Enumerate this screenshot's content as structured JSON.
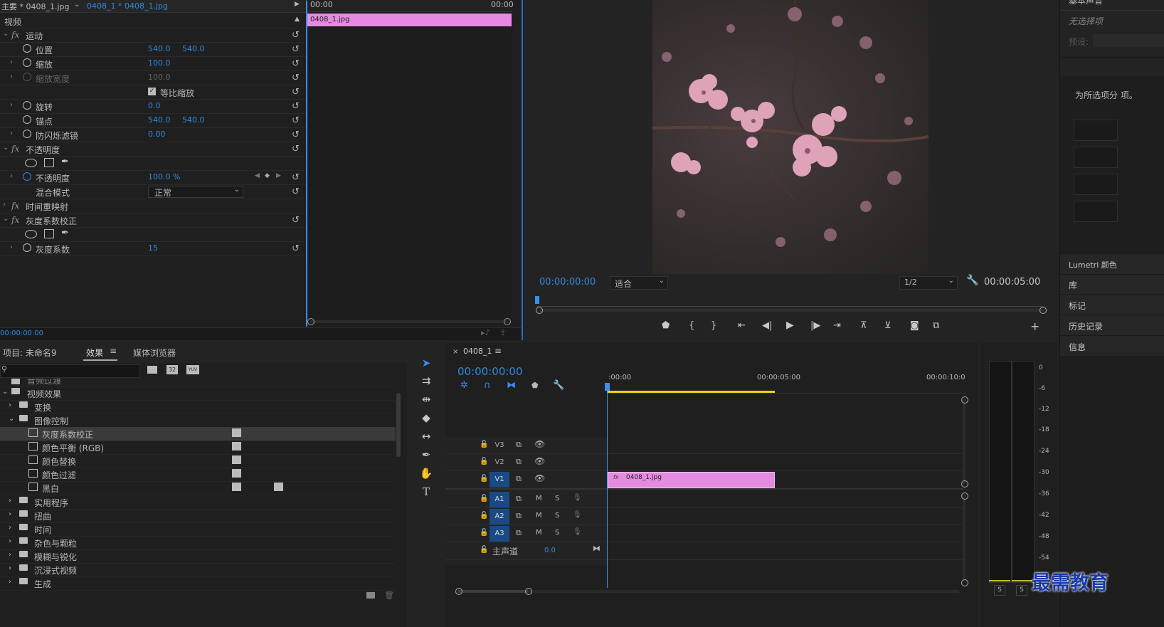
{
  "effect_controls": {
    "tab_main": "主要 * 0408_1.jpg",
    "tab_seq": "0408_1 * 0408_1.jpg",
    "section_video": "视频",
    "time_start": "00:00",
    "time_end": "00:00",
    "clip_label": "0408_1.jpg",
    "current_time": "00:00:00:00",
    "motion": "运动",
    "position_label": "位置",
    "position_x": "540.0",
    "position_y": "540.0",
    "scale_label": "缩放",
    "scale_value": "100.0",
    "scale_width_label": "缩放宽度",
    "scale_width_value": "100.0",
    "uniform_scale_label": "等比缩放",
    "rotation_label": "旋转",
    "rotation_value": "0.0",
    "anchor_label": "锚点",
    "anchor_x": "540.0",
    "anchor_y": "540.0",
    "flicker_label": "防闪烁滤镜",
    "flicker_value": "0.00",
    "opacity_group": "不透明度",
    "opacity_label": "不透明度",
    "opacity_value": "100.0 %",
    "blend_label": "混合模式",
    "blend_value": "正常",
    "time_remap": "时间重映射",
    "gamma_group": "灰度系数校正",
    "gamma_label": "灰度系数",
    "gamma_value": "15"
  },
  "program_monitor": {
    "timecode": "00:00:00:00",
    "fit_value": "适合",
    "quality_value": "1/2",
    "duration": "00:00:05:00"
  },
  "right_panel": {
    "title": "基本声音",
    "no_selection": "无选择项",
    "preset_label": "预设:",
    "hint": "为所选项分 项。",
    "items": [
      "Lumetri 颜色",
      "库",
      "标记",
      "历史记录",
      "信息"
    ]
  },
  "project_panel": {
    "tab_project": "项目: 未命名9",
    "tab_effects": "效果",
    "tab_media": "媒体浏览器",
    "badge_32": "32",
    "badge_yuv": "YUV",
    "cut_item": "音频过渡",
    "video_effects": "视频效果",
    "transform": "变换",
    "image_control": "图像控制",
    "effects": [
      "灰度系数校正",
      "颜色平衡 (RGB)",
      "颜色替换",
      "颜色过滤",
      "黑白"
    ],
    "folders": [
      "实用程序",
      "扭曲",
      "时间",
      "杂色与颗粒",
      "模糊与锐化",
      "沉浸式视频",
      "生成"
    ]
  },
  "timeline": {
    "tab": "0408_1",
    "timecode": "00:00:00:00",
    "ruler": [
      ":00:00",
      "00:00:05:00",
      "00:00:10:0"
    ],
    "tracks_video": [
      "V3",
      "V2",
      "V1"
    ],
    "tracks_audio": [
      "A1",
      "A2",
      "A3"
    ],
    "clip_label": "0408_1.jpg",
    "master_label": "主声道",
    "master_value": "0.0",
    "m_label": "M",
    "s_label": "S"
  },
  "audio_meter": {
    "scale": [
      "0",
      "-6",
      "-12",
      "-18",
      "-24",
      "-30",
      "-36",
      "-42",
      "-48",
      "-54"
    ],
    "solo": [
      "S",
      "S"
    ]
  },
  "watermark": "最需教育",
  "colors": {
    "accent_blue": "#2f8ae0",
    "clip_pink": "#e58ae0",
    "playhead": "#3a8ef0",
    "workarea": "#e8d21a"
  }
}
